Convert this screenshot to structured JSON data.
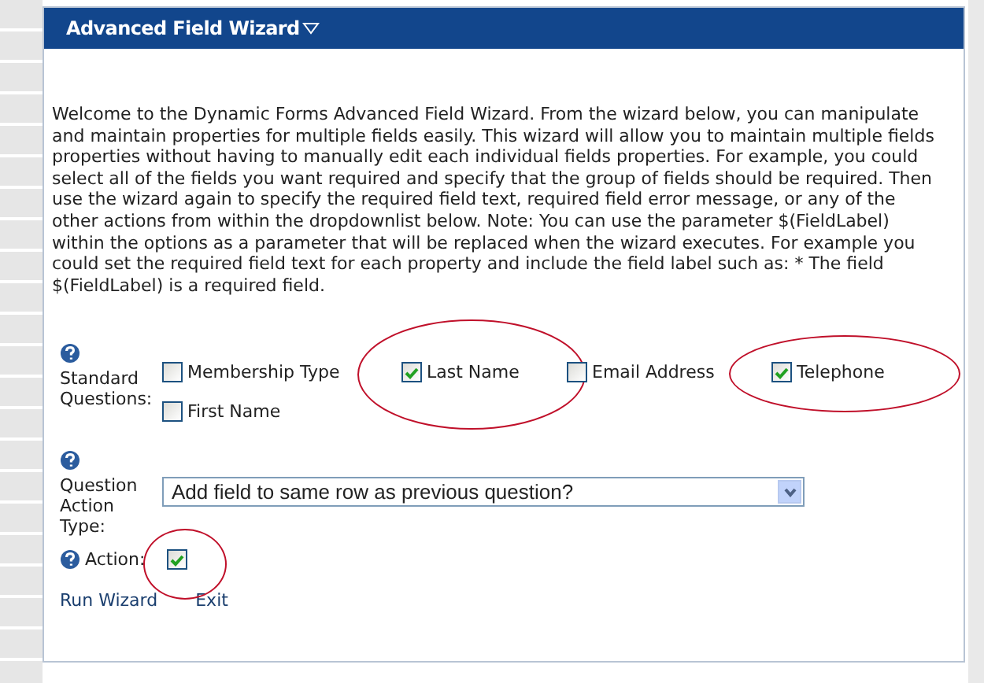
{
  "panel": {
    "title": "Advanced Field Wizard",
    "expanded": true
  },
  "intro": "Welcome to the Dynamic Forms Advanced Field Wizard. From the wizard below, you can manipulate and maintain properties for multiple fields easily. This wizard will allow you to maintain multiple fields properties without having to manually edit each individual fields properties. For example, you could select all of the fields you want required and specify that the group of fields should be required. Then use the wizard again to specify the required field text, required field error message, or any of the other actions from within the dropdownlist below. Note: You can use the parameter $(FieldLabel) within the options as a parameter that will be replaced when the wizard executes. For example you could set the required field text for each property and include the field label such as: * The field $(FieldLabel) is a required field.",
  "standard_questions": {
    "label": "Standard Questions:",
    "options": [
      {
        "label": "Membership Type",
        "checked": false,
        "circled": false
      },
      {
        "label": "Last Name",
        "checked": true,
        "circled": true
      },
      {
        "label": "Email Address",
        "checked": false,
        "circled": false
      },
      {
        "label": "Telephone",
        "checked": true,
        "circled": true
      },
      {
        "label": "First Name",
        "checked": false,
        "circled": false
      }
    ]
  },
  "question_action_type": {
    "label": "Question Action Type:",
    "value": "Add field to same row as previous question?"
  },
  "action": {
    "label": "Action:",
    "checked": true,
    "circled": true
  },
  "links": [
    "Run Wizard",
    "Exit"
  ]
}
